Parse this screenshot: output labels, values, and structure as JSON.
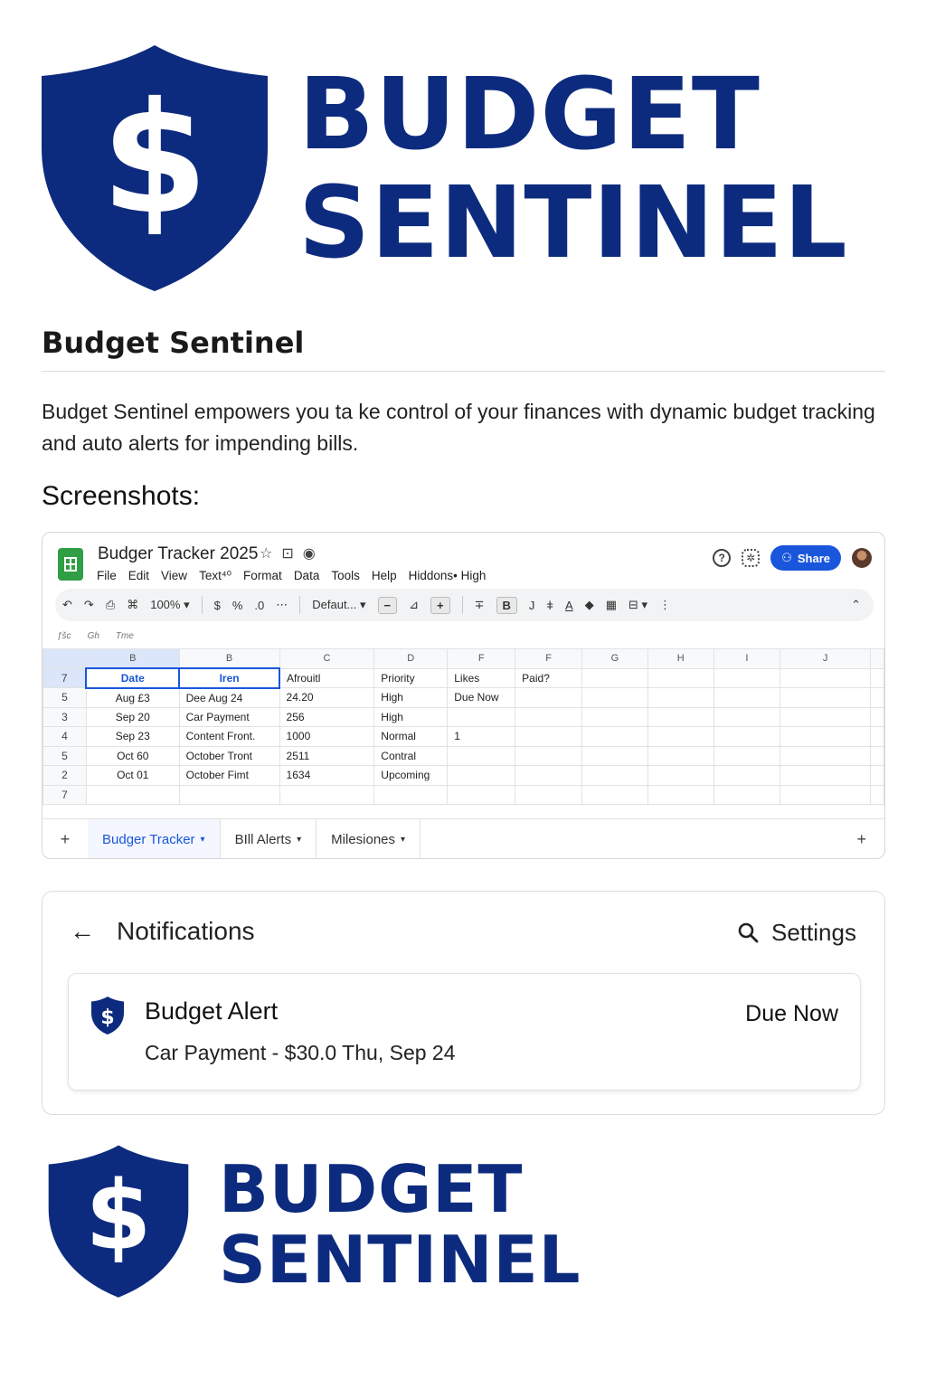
{
  "brand": {
    "line1": "BUDGET",
    "line2": "SENTINEL",
    "color": "#0d2b7e",
    "logo_icon": "shield-dollar-icon"
  },
  "page": {
    "title": "Budget Sentinel",
    "description": "Budget Sentinel empowers you ta ke control of your finances with dynamic budget tracking and auto alerts for impending bills.",
    "screenshots_label": "Screenshots:"
  },
  "sheet": {
    "doc_title": "Budger Tracker 2025",
    "menu": [
      "File",
      "Edit",
      "View",
      "Text⁴⁰",
      "Format",
      "Data",
      "Tools",
      "Help",
      "Hiddons• High"
    ],
    "share_label": "Share",
    "toolbar": {
      "zoom": "100%",
      "font": "Defaut...",
      "bold": "B",
      "italic": "J"
    },
    "formula_bar": [
      "ƒšc",
      "Gh",
      "Tme"
    ],
    "column_letters": [
      "B",
      "B",
      "C",
      "D",
      "F",
      "F",
      "G",
      "H",
      "I",
      "J"
    ],
    "header_row": {
      "rownum": "7",
      "cells": [
        "Date",
        "Iren",
        "Afrouitl",
        "Priority",
        "Likes",
        "Paid?",
        "",
        "",
        "",
        ""
      ]
    },
    "rows": [
      {
        "rownum": "5",
        "cells": [
          "Aug £3",
          "Dee Aug 24",
          "24.20",
          "High",
          "Due Now",
          "",
          "",
          "",
          "",
          ""
        ]
      },
      {
        "rownum": "3",
        "cells": [
          "Sep 20",
          "Car Payment",
          "256",
          "High",
          "",
          "",
          "",
          "",
          "",
          ""
        ]
      },
      {
        "rownum": "4",
        "cells": [
          "Sep 23",
          "Content Front.",
          "1000",
          "Normal",
          "1",
          "",
          "",
          "",
          "",
          ""
        ]
      },
      {
        "rownum": "5",
        "cells": [
          "Oct 60",
          "October Tront",
          "2511",
          "Contral",
          "",
          "",
          "",
          "",
          "",
          ""
        ]
      },
      {
        "rownum": "2",
        "cells": [
          "Oct 01",
          "October Fimt",
          "1634",
          "Upcoming",
          "",
          "",
          "",
          "",
          "",
          ""
        ]
      },
      {
        "rownum": "7",
        "cells": [
          "",
          "",
          "",
          "",
          "",
          "",
          "",
          "",
          "",
          ""
        ]
      }
    ],
    "tabs": [
      {
        "label": "Budger Tracker",
        "active": true
      },
      {
        "label": "BIll Alerts",
        "active": false
      },
      {
        "label": "Milesiones",
        "active": false
      }
    ],
    "accent": "#1a56db",
    "app_color": "#2f9e44"
  },
  "notifications": {
    "title": "Notifications",
    "settings_label": "Settings",
    "alert": {
      "title": "Budget Alert",
      "body": "Car Payment - $30.0 Thu, Sep 24",
      "status": "Due Now"
    }
  }
}
